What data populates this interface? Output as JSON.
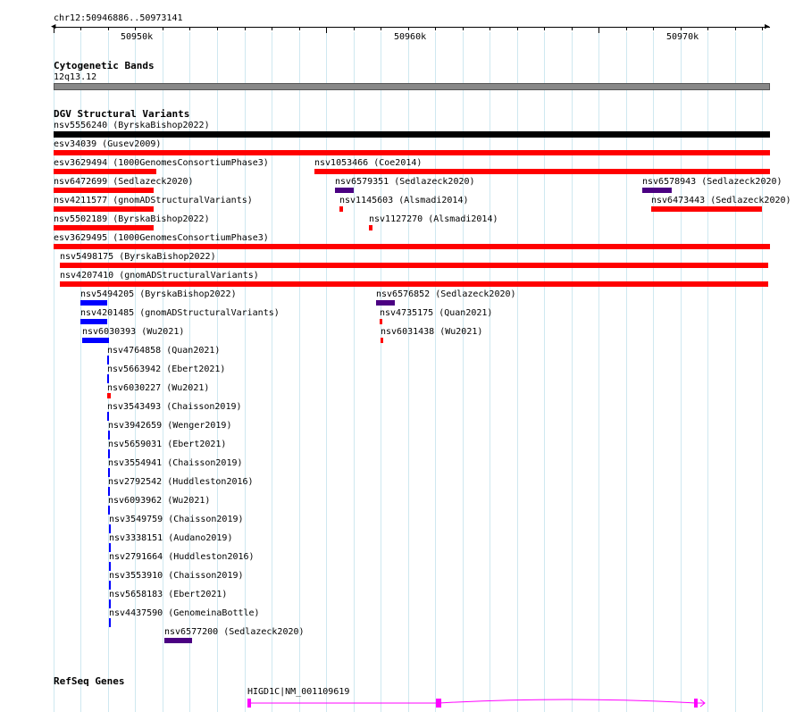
{
  "header": {
    "location": "chr12:50946886..50973141"
  },
  "ruler": {
    "labels": [
      "50950k",
      "50960k",
      "50970k"
    ]
  },
  "colors": {
    "cnv_loss": "#ff0000",
    "cnv_gain": "#0000ff",
    "inversion": "#4b0082",
    "gene": "#ff00ff",
    "band": "#888888",
    "grid": "#cfe8f0"
  },
  "tracks": {
    "cytobands": {
      "title": "Cytogenetic Bands",
      "band": "12q13.12"
    },
    "dgv": {
      "title": "DGV Structural Variants",
      "features": [
        {
          "label": "nsv5556240 (ByrskaBishop2022)",
          "color": "black"
        },
        {
          "label": "esv34039 (Gusev2009)",
          "color": "red"
        },
        {
          "label": "esv3629494 (1000GenomesConsortiumPhase3)",
          "color": "red"
        },
        {
          "label": "nsv1053466 (Coe2014)",
          "color": "red"
        },
        {
          "label": "nsv6472699 (Sedlazeck2020)",
          "color": "red"
        },
        {
          "label": "nsv6579351 (Sedlazeck2020)",
          "color": "purple"
        },
        {
          "label": "nsv6578943 (Sedlazeck2020)",
          "color": "purple"
        },
        {
          "label": "nsv4211577 (gnomADStructuralVariants)",
          "color": "red"
        },
        {
          "label": "nsv1145603 (Alsmadi2014)",
          "color": "red"
        },
        {
          "label": "nsv6473443 (Sedlazeck2020)",
          "color": "red"
        },
        {
          "label": "nsv5502189 (ByrskaBishop2022)",
          "color": "red"
        },
        {
          "label": "nsv1127270 (Alsmadi2014)",
          "color": "red"
        },
        {
          "label": "esv3629495 (1000GenomesConsortiumPhase3)",
          "color": "red"
        },
        {
          "label": "nsv5498175 (ByrskaBishop2022)",
          "color": "red"
        },
        {
          "label": "nsv4207410 (gnomADStructuralVariants)",
          "color": "red"
        },
        {
          "label": "nsv5494205 (ByrskaBishop2022)",
          "color": "blue"
        },
        {
          "label": "nsv6576852 (Sedlazeck2020)",
          "color": "purple"
        },
        {
          "label": "nsv4201485 (gnomADStructuralVariants)",
          "color": "blue"
        },
        {
          "label": "nsv4735175 (Quan2021)",
          "color": "red"
        },
        {
          "label": "nsv6030393 (Wu2021)",
          "color": "blue"
        },
        {
          "label": "nsv6031438 (Wu2021)",
          "color": "red"
        },
        {
          "label": "nsv4764858 (Quan2021)",
          "color": "blue"
        },
        {
          "label": "nsv5663942 (Ebert2021)",
          "color": "blue"
        },
        {
          "label": "nsv6030227 (Wu2021)",
          "color": "red"
        },
        {
          "label": "nsv3543493 (Chaisson2019)",
          "color": "blue"
        },
        {
          "label": "nsv3942659 (Wenger2019)",
          "color": "blue"
        },
        {
          "label": "nsv5659031 (Ebert2021)",
          "color": "blue"
        },
        {
          "label": "nsv3554941 (Chaisson2019)",
          "color": "blue"
        },
        {
          "label": "nsv2792542 (Huddleston2016)",
          "color": "blue"
        },
        {
          "label": "nsv6093962 (Wu2021)",
          "color": "blue"
        },
        {
          "label": "nsv3549759 (Chaisson2019)",
          "color": "blue"
        },
        {
          "label": "nsv3338151 (Audano2019)",
          "color": "blue"
        },
        {
          "label": "nsv2791664 (Huddleston2016)",
          "color": "blue"
        },
        {
          "label": "nsv3553910 (Chaisson2019)",
          "color": "blue"
        },
        {
          "label": "nsv5658183 (Ebert2021)",
          "color": "blue"
        },
        {
          "label": "nsv4437590 (GenomeinaBottle)",
          "color": "blue"
        },
        {
          "label": "nsv6577200 (Sedlazeck2020)",
          "color": "purple"
        }
      ]
    },
    "refseq": {
      "title": "RefSeq Genes",
      "gene_label": "HIGD1C|NM_001109619"
    }
  }
}
